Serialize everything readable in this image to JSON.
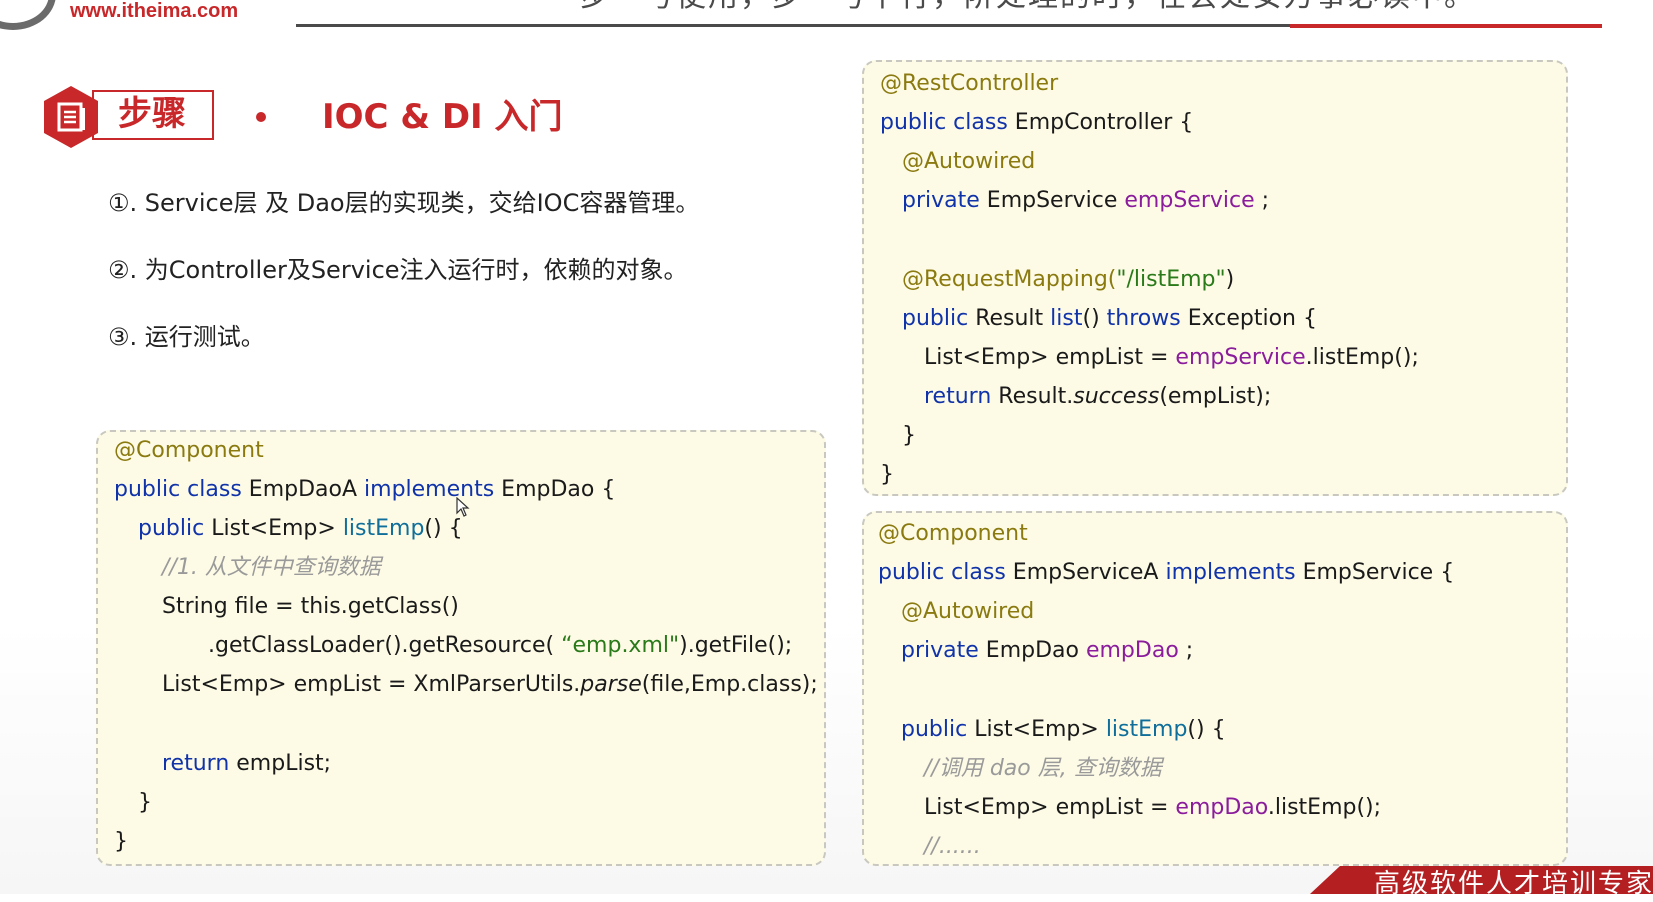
{
  "header": {
    "site_url": "www.itheima.com",
    "slogan": "步一号使用，步一号下行，阶处理的时，在会处安万事必读中。"
  },
  "section": {
    "badge_label": "步骤",
    "title": "IOC & DI 入门"
  },
  "steps": [
    "①. Service层 及 Dao层的实现类，交给IOC容器管理。",
    "②. 为Controller及Service注入运行时，依赖的对象。",
    "③. 运行测试。"
  ],
  "code_dao": {
    "l1": "@Component",
    "l2_kw": "public class",
    "l2_name": " EmpDaoA ",
    "l2_impl": "implements",
    "l2_rest": " EmpDao {",
    "l3_kw": "public",
    "l3_type": " List<Emp> ",
    "l3_m": "listEmp",
    "l3_rest": "() {",
    "l4": "//1. 从文件中查询数据",
    "l5": "String file = this.getClass()",
    "l6_a": ".getClassLoader().getResource(  ",
    "l6_str": "“emp.xml\"",
    "l6_b": ").getFile();",
    "l7_a": "List<Emp> empList = XmlParserUtils.",
    "l7_m": "parse",
    "l7_b": "(file,Emp.class);",
    "l8_kw": "return",
    "l8_rest": " empList;",
    "l9": "}",
    "l10": "}"
  },
  "code_controller": {
    "l1": "@RestController",
    "l2_kw": "public class",
    "l2_rest": " EmpController {",
    "l3": "@Autowired",
    "l4_kw": "private",
    "l4_type": " EmpService ",
    "l4_f": "empService",
    "l4_rest": " ;",
    "l5_ann": "@RequestMapping(",
    "l5_str": "\"/listEmp\"",
    "l5_rest": ")",
    "l6_kw": "public",
    "l6_type": " Result ",
    "l6_m": "list",
    "l6_mid": "() ",
    "l6_throws": "throws",
    "l6_rest": " Exception {",
    "l7_a": "List<Emp> empList = ",
    "l7_f": "empService",
    "l7_b": ".listEmp();",
    "l8_kw": "return",
    "l8_a": " Result.",
    "l8_m": "success",
    "l8_b": "(empList);",
    "l9": "}",
    "l10": "}"
  },
  "code_service": {
    "l1": "@Component",
    "l2_kw": "public class",
    "l2_name": " EmpServiceA ",
    "l2_impl": "implements",
    "l2_rest": " EmpService {",
    "l3": "@Autowired",
    "l4_kw": "private",
    "l4_type": " EmpDao ",
    "l4_f": "empDao",
    "l4_rest": " ;",
    "l5_kw": "public",
    "l5_type": " List<Emp> ",
    "l5_m": "listEmp",
    "l5_rest": "()  {",
    "l6": "//调用 dao 层, 查询数据",
    "l7_a": "List<Emp> empList = ",
    "l7_f": "empDao",
    "l7_b": ".listEmp();",
    "l8": "//......"
  },
  "footer": {
    "banner_text": "高级软件人才培训专家"
  },
  "colors": {
    "brand_red": "#c8282a",
    "keyword_blue": "#1133aa",
    "annotation_olive": "#8a7a10",
    "field_purple": "#8b1c9c",
    "code_background": "#fdfbe6"
  }
}
